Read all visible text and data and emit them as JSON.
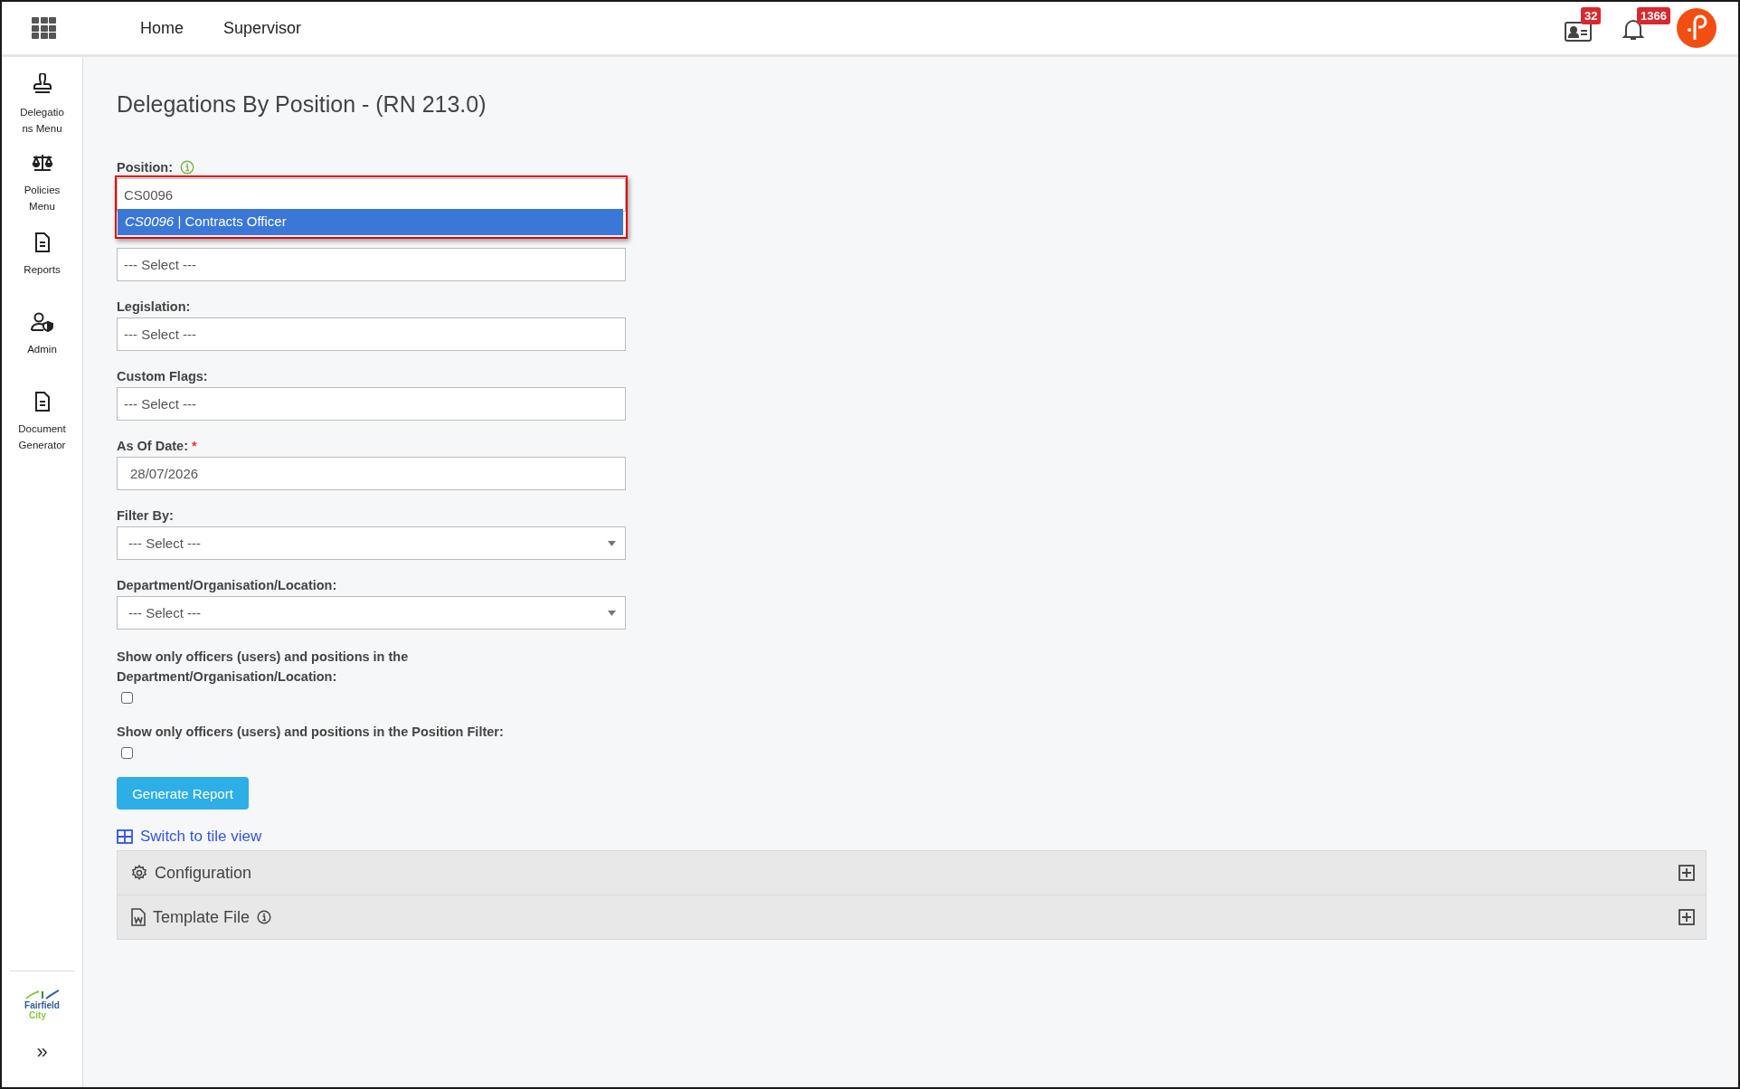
{
  "topbar": {
    "nav": [
      {
        "label": "Home"
      },
      {
        "label": "Supervisor"
      }
    ],
    "notifications": [
      {
        "kind": "contact",
        "count": "32"
      },
      {
        "kind": "bell",
        "count": "1366"
      }
    ]
  },
  "sidebar": {
    "items": [
      {
        "kind": "stamp",
        "label": "Delegations Menu"
      },
      {
        "kind": "scales",
        "label": "Policies Menu"
      },
      {
        "kind": "document",
        "label": "Reports"
      },
      {
        "kind": "admin",
        "label": "Admin"
      },
      {
        "kind": "document",
        "label": "Document Generator"
      }
    ],
    "logo": {
      "line_1": "Fairfield",
      "line_2": "City"
    },
    "collapse": "»"
  },
  "page": {
    "title": "Delegations By Position - (RN 213.0)"
  },
  "form": {
    "fields": [
      {
        "kind": "combobox",
        "label": "Position:",
        "info": true,
        "value": "CS0096",
        "options": [
          {
            "text": "*CS0096* | Contracts Officer",
            "selected": true
          }
        ]
      },
      {
        "kind": "picker",
        "placeholder": "--- Select ---"
      },
      {
        "kind": "picker",
        "label": "Legislation:",
        "placeholder": "--- Select ---"
      },
      {
        "kind": "picker",
        "label": "Custom Flags:",
        "placeholder": "--- Select ---"
      },
      {
        "kind": "date",
        "label": "As Of Date:",
        "required_mark": "*",
        "value": "28/07/2026"
      },
      {
        "kind": "dropdown",
        "label": "Filter By:",
        "value": "--- Select ---"
      },
      {
        "kind": "dropdown",
        "label": "Department/Organisation/Location:",
        "value": "--- Select ---"
      },
      {
        "kind": "checkbox",
        "label": "Show only officers (users) and positions in the Department/Organisation/Location:",
        "checked": false
      },
      {
        "kind": "checkbox",
        "label": "Show only officers (users) and positions in the Position Filter:",
        "checked": false
      }
    ],
    "submit": "Generate Report"
  },
  "view_link": {
    "label": "Switch to tile view"
  },
  "panels": [
    {
      "kind": "configuration",
      "title": "Configuration",
      "info": false,
      "expanded": false
    },
    {
      "kind": "template",
      "title": "Template File",
      "info": true,
      "expanded": false
    }
  ]
}
